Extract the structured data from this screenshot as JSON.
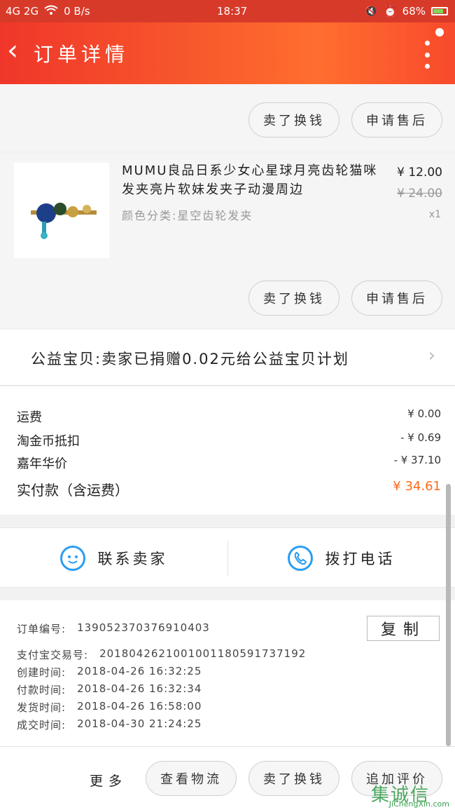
{
  "status_bar": {
    "network": "4G 2G",
    "speed": "0 B/s",
    "time": "18:37",
    "battery": "68%"
  },
  "nav": {
    "title": "订单详情"
  },
  "top_actions": {
    "sell_label": "卖了换钱",
    "aftersale_label": "申请售后"
  },
  "product": {
    "title": "MUMU良品日系少女心星球月亮齿轮猫咪发夹亮片软妹发夹子动漫周边",
    "attr": "颜色分类:星空齿轮发夹",
    "price": "¥ 12.00",
    "original_price": "¥ 24.00",
    "qty": "x1",
    "sell_label": "卖了换钱",
    "aftersale_label": "申请售后"
  },
  "charity": {
    "text": "公益宝贝:卖家已捐赠0.02元给公益宝贝计划"
  },
  "fees": {
    "shipping_label": "运费",
    "shipping_value": "¥ 0.00",
    "coins_label": "淘金币抵扣",
    "coins_value": "- ¥ 0.69",
    "anniv_label": "嘉年华价",
    "anniv_value": "- ¥ 37.10",
    "total_label": "实付款（含运费）",
    "total_value": "¥ 34.61"
  },
  "contact": {
    "seller_label": "联系卖家",
    "call_label": "拨打电话"
  },
  "order_info": {
    "order_no_label": "订单编号:",
    "order_no": "139052370376910403",
    "alipay_label": "支付宝交易号:",
    "alipay_no": "2018042621001001180591737192",
    "created_label": "创建时间:",
    "created": "2018-04-26 16:32:25",
    "paid_label": "付款时间:",
    "paid": "2018-04-26 16:32:34",
    "shipped_label": "发货时间:",
    "shipped": "2018-04-26 16:58:00",
    "done_label": "成交时间:",
    "done": "2018-04-30 21:24:25",
    "copy_label": "复制"
  },
  "bottom": {
    "more_label": "更多",
    "logistics_label": "查看物流",
    "sell_label": "卖了换钱",
    "review_label": "追加评价"
  },
  "watermark": {
    "logo": "集诚信",
    "sub": "JiChengXin.com"
  },
  "colors": {
    "accent": "#f0362a",
    "total": "#ff6a1a",
    "icon": "#2a9df4"
  }
}
